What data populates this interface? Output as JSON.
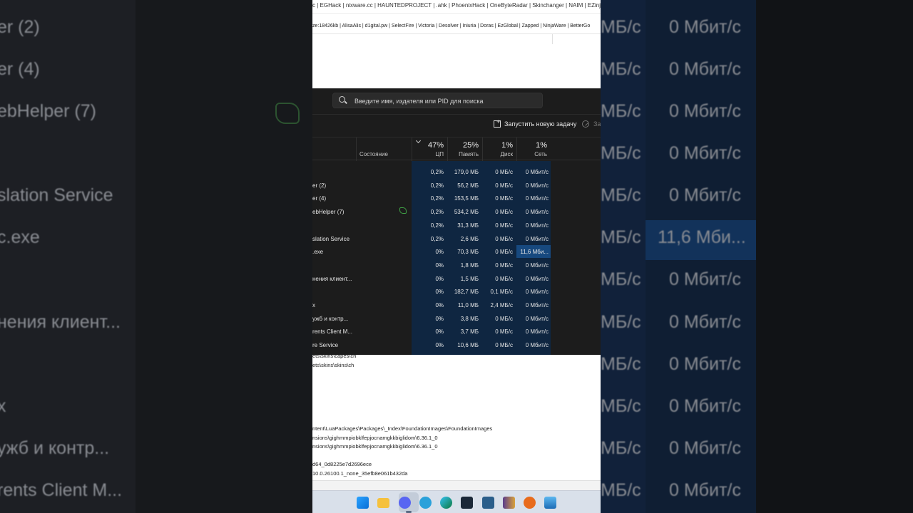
{
  "background_left": {
    "rows": [
      "er (2)",
      "er (4)",
      "ebHelper (7)",
      "slation Service",
      "c.exe",
      "нения клиент...",
      "x",
      "ужб и контр...",
      "rents Client M..."
    ]
  },
  "background_right": {
    "disk_rows": [
      "МБ/с",
      "МБ/с",
      "МБ/с",
      "МБ/с",
      "МБ/с",
      "МБ/с",
      "МБ/с",
      "МБ/с",
      "МБ/с",
      "МБ/с",
      "МБ/с",
      "МБ/с"
    ],
    "net_rows": [
      "0 Мбит/с",
      "0 Мбит/с",
      "0 Мбит/с",
      "0 Мбит/с",
      "0 Мбит/с",
      "11,6 Мби...",
      "0 Мбит/с",
      "0 Мбит/с",
      "0 Мбит/с",
      "0 Мбит/с",
      "0 Мбит/с",
      "0 Мбит/с"
    ]
  },
  "topbar": {
    "line1": "c | EGHack | nixware.cc | HAUNTEDPROJECT | .ahk | PhoenixHack | OneByteRadar | Skinchanger | NAIM | EZinjector |",
    "line2": "ze:18426kb | AlisaAlis | d1gital.pw | SelectFire | Victoria | Desolver | Iniuria | Doras | EzGlobal | Zapped | NinjaWare | BetterGo"
  },
  "task_manager": {
    "search_placeholder": "Введите имя, издателя или PID для поиска",
    "new_task_label": "Запустить новую задачу",
    "end_task_label": "За",
    "columns": {
      "status": "Состояние",
      "cpu": {
        "pct": "47%",
        "label": "ЦП"
      },
      "memory": {
        "pct": "25%",
        "label": "Память"
      },
      "disk": {
        "pct": "1%",
        "label": "Диск"
      },
      "network": {
        "pct": "1%",
        "label": "Сеть"
      }
    },
    "rows": [
      {
        "name": "",
        "cpu": "0,2%",
        "mem": "179,0 МБ",
        "disk": "0 МБ/с",
        "net": "0 Мбит/с"
      },
      {
        "name": "er (2)",
        "cpu": "0,2%",
        "mem": "56,2 МБ",
        "disk": "0 МБ/с",
        "net": "0 Мбит/с"
      },
      {
        "name": "er (4)",
        "cpu": "0,2%",
        "mem": "153,5 МБ",
        "disk": "0 МБ/с",
        "net": "0 Мбит/с"
      },
      {
        "name": "ebHelper (7)",
        "cpu": "0,2%",
        "mem": "534,2 МБ",
        "disk": "0 МБ/с",
        "net": "0 Мбит/с"
      },
      {
        "name": "",
        "cpu": "0,2%",
        "mem": "31,3 МБ",
        "disk": "0 МБ/с",
        "net": "0 Мбит/с"
      },
      {
        "name": "slation Service",
        "cpu": "0,2%",
        "mem": "2,6 МБ",
        "disk": "0 МБ/с",
        "net": "0 Мбит/с"
      },
      {
        "name": ".exe",
        "cpu": "0%",
        "mem": "70,3 МБ",
        "disk": "0 МБ/с",
        "net": "11,6 Мби..."
      },
      {
        "name": "",
        "cpu": "0%",
        "mem": "1,8 МБ",
        "disk": "0 МБ/с",
        "net": "0 Мбит/с"
      },
      {
        "name": "нения клиент...",
        "cpu": "0%",
        "mem": "1,5 МБ",
        "disk": "0 МБ/с",
        "net": "0 Мбит/с"
      },
      {
        "name": "",
        "cpu": "0%",
        "mem": "182,7 МБ",
        "disk": "0,1 МБ/с",
        "net": "0 Мбит/с"
      },
      {
        "name": "x",
        "cpu": "0%",
        "mem": "11,0 МБ",
        "disk": "2,4 МБ/с",
        "net": "0 Мбит/с"
      },
      {
        "name": "ужб и контр...",
        "cpu": "0%",
        "mem": "3,8 МБ",
        "disk": "0 МБ/с",
        "net": "0 Мбит/с"
      },
      {
        "name": "rents Client M...",
        "cpu": "0%",
        "mem": "3,7 МБ",
        "disk": "0 МБ/с",
        "net": "0 Мбит/с"
      },
      {
        "name": "re Service",
        "cpu": "0%",
        "mem": "10,6 МБ",
        "disk": "0 МБ/с",
        "net": "0 Мбит/с"
      }
    ]
  },
  "lower_editor": {
    "lines": [
      "ets\\skins\\capes\\ch",
      "ets\\skins\\skins\\ch",
      "ntent\\LuaPackages\\Packages\\_Index\\FoundationImages\\FoundationImages",
      "nsions\\gighmmpiobklfepjocnamgkkbiglidom\\6.36.1_0",
      "nsions\\gighmmpiobklfepjocnamgkkbiglidom\\6.36.1_0",
      "d64_0d8225e7d2696ece",
      "10.0.26100.1_none_35efb8e061b432da"
    ]
  },
  "taskbar": {
    "icons": [
      "windows-start",
      "file-explorer",
      "discord",
      "telegram",
      "edge",
      "steam",
      "vpn-app",
      "winrar",
      "search-tool",
      "photos"
    ]
  }
}
